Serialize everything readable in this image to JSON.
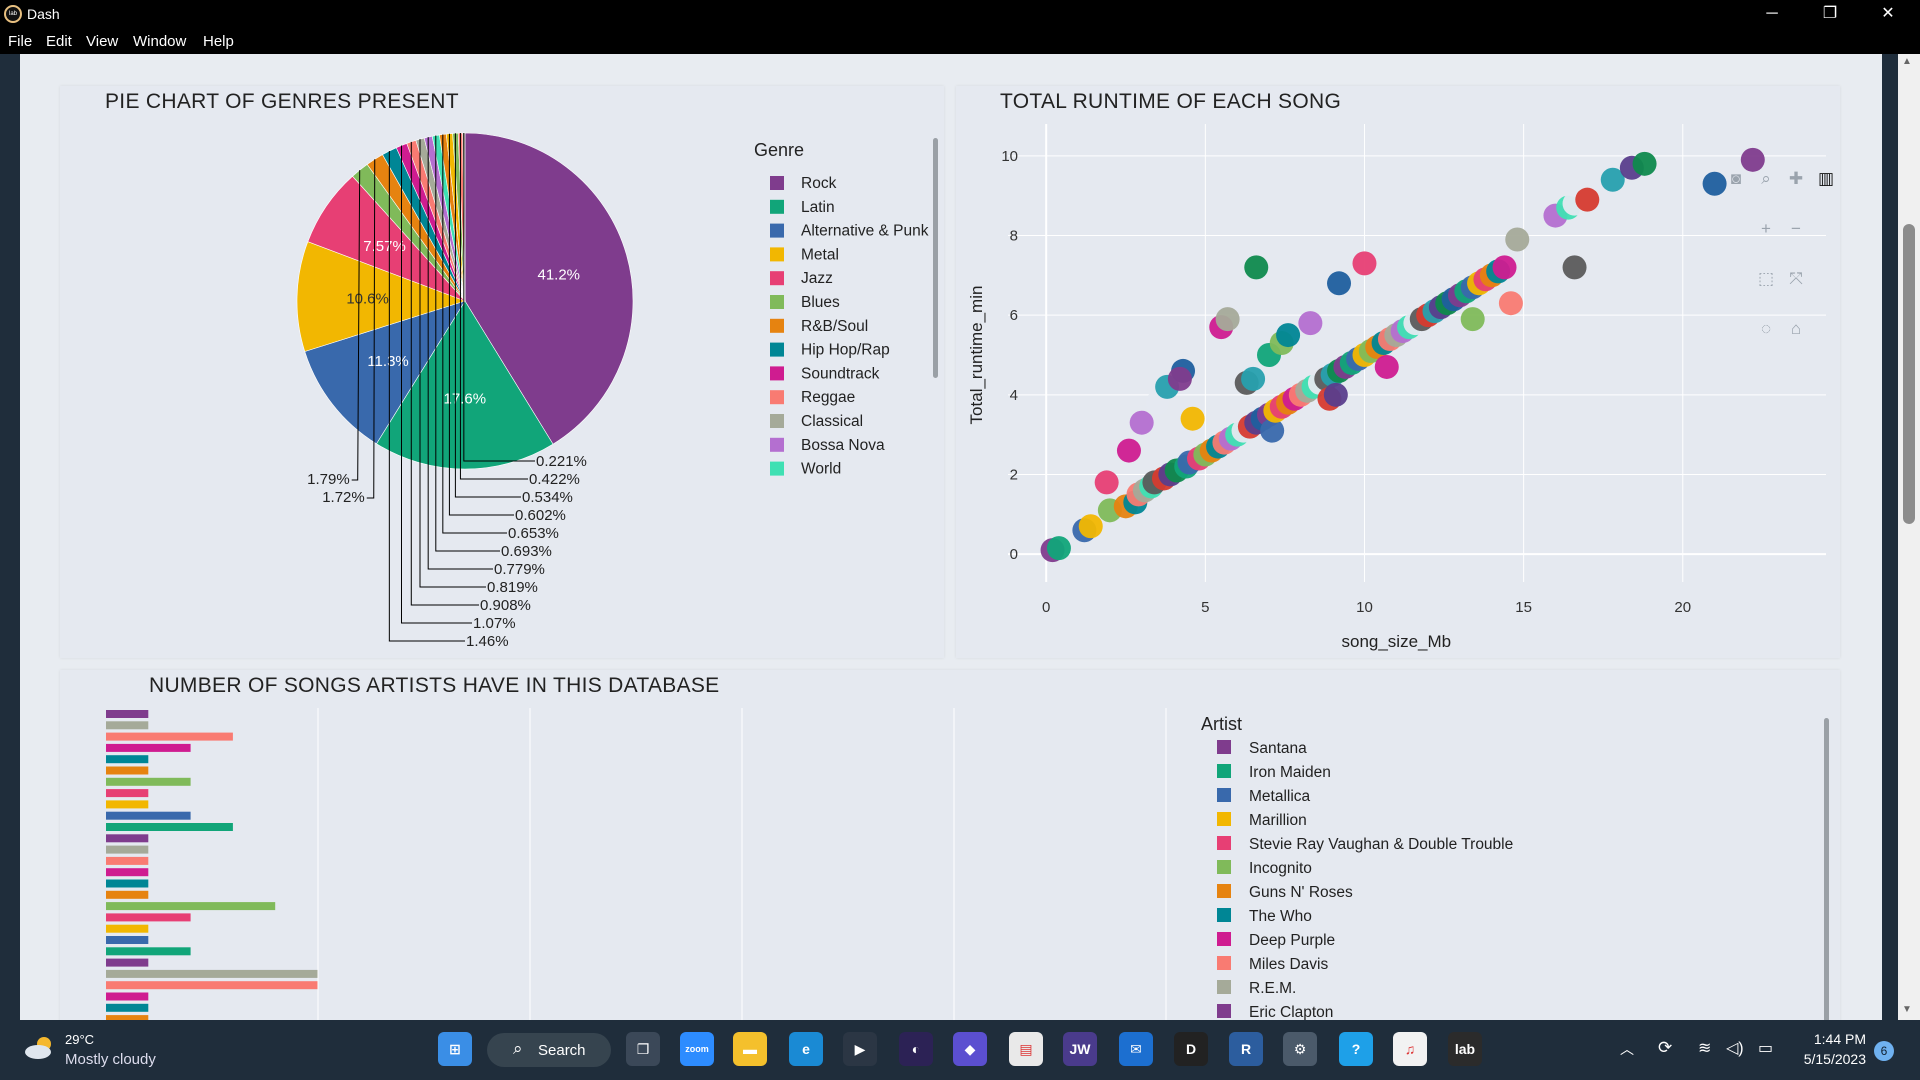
{
  "window": {
    "title": "Dash",
    "app_icon_text": "lab",
    "minimize": "─",
    "restore": "❐",
    "close": "✕"
  },
  "menu": [
    "File",
    "Edit",
    "View",
    "Window",
    "Help"
  ],
  "pie_chart": {
    "title": "PIE CHART OF GENRES PRESENT",
    "legend_title": "Genre",
    "chart_data": {
      "type": "pie",
      "labels": [
        "Rock",
        "Latin",
        "Alternative & Punk",
        "Metal",
        "Jazz",
        "Blues",
        "R&B/Soul",
        "Hip Hop/Rap",
        "Soundtrack",
        "Reggae",
        "Classical",
        "Bossa Nova",
        "World"
      ],
      "colors": [
        "#7f3c8d",
        "#11a579",
        "#3969ac",
        "#f2b701",
        "#e73f74",
        "#80ba5a",
        "#e68310",
        "#008695",
        "#cf1c90",
        "#f97b72",
        "#a5aa99",
        "#b46fd0",
        "#3fe0b3"
      ],
      "slices": [
        {
          "value": 41.2,
          "label": "41.2%",
          "color": "#7f3c8d"
        },
        {
          "value": 17.6,
          "label": "17.6%",
          "color": "#11a579"
        },
        {
          "value": 11.3,
          "label": "11.3%",
          "color": "#3969ac"
        },
        {
          "value": 10.6,
          "label": "10.6%",
          "color": "#f2b701"
        },
        {
          "value": 7.57,
          "label": "7.57%",
          "color": "#e73f74"
        },
        {
          "value": 1.79,
          "label": "1.79%",
          "color": "#80ba5a"
        },
        {
          "value": 1.72,
          "label": "1.72%",
          "color": "#e68310"
        },
        {
          "value": 1.46,
          "label": "1.46%",
          "color": "#008695"
        },
        {
          "value": 1.07,
          "label": "1.07%",
          "color": "#cf1c90"
        },
        {
          "value": 0.908,
          "label": "0.908%",
          "color": "#f97b72"
        },
        {
          "value": 0.819,
          "label": "0.819%",
          "color": "#a5aa99"
        },
        {
          "value": 0.779,
          "label": "0.779%",
          "color": "#b46fd0"
        },
        {
          "value": 0.693,
          "label": "0.693%",
          "color": "#3fe0b3"
        },
        {
          "value": 0.653,
          "label": "0.653%",
          "color": "#e68310"
        },
        {
          "value": 0.602,
          "label": "0.602%",
          "color": "#f2b701"
        },
        {
          "value": 0.534,
          "label": "0.534%",
          "color": "#80ba5a"
        },
        {
          "value": 0.422,
          "label": "0.422%",
          "color": "#f97b72"
        },
        {
          "value": 0.221,
          "label": "0.221%",
          "color": "#a5aa99"
        }
      ]
    }
  },
  "scatter_chart": {
    "title": "TOTAL RUNTIME OF EACH SONG",
    "chart_data": {
      "type": "scatter",
      "xlabel": "song_size_Mb",
      "ylabel": "Total_runtime_min",
      "xlim": [
        -1.2,
        24.5
      ],
      "ylim": [
        -0.7,
        10.8
      ],
      "xticks": [
        "0",
        "5",
        "10",
        "15",
        "20"
      ],
      "yticks": [
        "0",
        "2",
        "4",
        "6",
        "8",
        "10"
      ],
      "colors": [
        "#7f3c8d",
        "#11a579",
        "#3969ac",
        "#f2b701",
        "#e73f74",
        "#80ba5a",
        "#e68310",
        "#008695",
        "#cf1c90",
        "#f97b72",
        "#a5aa99",
        "#b46fd0",
        "#3fe0b3",
        "#e5e9f0",
        "#5b5b5b",
        "#d63b2f",
        "#27a0ae",
        "#5a3e8c",
        "#0f8a4d",
        "#1f5f9e"
      ],
      "points": [
        [
          0.2,
          0.1
        ],
        [
          0.4,
          0.15
        ],
        [
          1.2,
          0.6
        ],
        [
          1.4,
          0.7
        ],
        [
          1.9,
          1.8
        ],
        [
          2.0,
          1.1
        ],
        [
          2.5,
          1.2
        ],
        [
          2.8,
          1.3
        ],
        [
          2.6,
          2.6
        ],
        [
          2.9,
          1.5
        ],
        [
          3.1,
          1.6
        ],
        [
          3.0,
          3.3
        ],
        [
          3.3,
          1.7
        ],
        [
          3.5,
          3.8
        ],
        [
          3.4,
          1.8
        ],
        [
          3.7,
          1.9
        ],
        [
          3.8,
          4.2
        ],
        [
          3.9,
          2.0
        ],
        [
          4.1,
          2.1
        ],
        [
          4.3,
          4.6
        ],
        [
          4.2,
          4.4
        ],
        [
          4.4,
          2.2
        ],
        [
          4.5,
          2.3
        ],
        [
          4.6,
          3.4
        ],
        [
          4.8,
          2.4
        ],
        [
          5.0,
          2.5
        ],
        [
          5.2,
          2.6
        ],
        [
          5.4,
          2.7
        ],
        [
          5.5,
          5.7
        ],
        [
          5.6,
          2.8
        ],
        [
          5.7,
          5.9
        ],
        [
          5.8,
          2.9
        ],
        [
          6.0,
          3.0
        ],
        [
          6.2,
          3.1
        ],
        [
          6.3,
          4.3
        ],
        [
          6.4,
          3.2
        ],
        [
          6.5,
          4.4
        ],
        [
          6.6,
          3.3
        ],
        [
          6.6,
          7.2
        ],
        [
          6.8,
          3.4
        ],
        [
          7.0,
          3.5
        ],
        [
          7.0,
          5.0
        ],
        [
          7.1,
          3.1
        ],
        [
          7.2,
          3.6
        ],
        [
          7.4,
          3.7
        ],
        [
          7.4,
          5.3
        ],
        [
          7.6,
          3.8
        ],
        [
          7.6,
          5.5
        ],
        [
          7.8,
          3.9
        ],
        [
          8.0,
          4.0
        ],
        [
          8.2,
          4.1
        ],
        [
          8.3,
          5.8
        ],
        [
          8.4,
          4.2
        ],
        [
          8.6,
          4.3
        ],
        [
          8.8,
          4.4
        ],
        [
          8.9,
          3.9
        ],
        [
          9.0,
          4.5
        ],
        [
          9.1,
          4.0
        ],
        [
          9.2,
          4.6
        ],
        [
          9.2,
          6.8
        ],
        [
          9.4,
          4.7
        ],
        [
          9.6,
          4.8
        ],
        [
          9.8,
          4.9
        ],
        [
          10.0,
          5.0
        ],
        [
          10.0,
          7.3
        ],
        [
          10.2,
          5.1
        ],
        [
          10.4,
          5.2
        ],
        [
          10.6,
          5.3
        ],
        [
          10.7,
          4.7
        ],
        [
          10.8,
          5.4
        ],
        [
          11.0,
          5.5
        ],
        [
          11.2,
          5.6
        ],
        [
          11.4,
          5.7
        ],
        [
          11.6,
          5.8
        ],
        [
          11.8,
          5.9
        ],
        [
          12.0,
          6.0
        ],
        [
          12.2,
          6.1
        ],
        [
          12.4,
          6.2
        ],
        [
          12.6,
          6.3
        ],
        [
          12.8,
          6.4
        ],
        [
          13.0,
          6.5
        ],
        [
          13.2,
          6.6
        ],
        [
          13.4,
          6.7
        ],
        [
          13.6,
          6.8
        ],
        [
          13.8,
          6.9
        ],
        [
          13.4,
          5.9
        ],
        [
          14.0,
          7.0
        ],
        [
          14.2,
          7.1
        ],
        [
          14.4,
          7.2
        ],
        [
          14.6,
          6.3
        ],
        [
          14.8,
          7.9
        ],
        [
          16.0,
          8.5
        ],
        [
          16.4,
          8.7
        ],
        [
          16.6,
          8.8
        ],
        [
          16.6,
          7.2
        ],
        [
          17.0,
          8.9
        ],
        [
          17.8,
          9.4
        ],
        [
          18.4,
          9.7
        ],
        [
          18.8,
          9.8
        ],
        [
          21.0,
          9.3
        ],
        [
          22.2,
          9.9
        ]
      ]
    }
  },
  "plot_toolbar": [
    "camera-icon",
    "zoom-icon",
    "pan-icon",
    "autoscale-icon",
    "zoom-in-icon",
    "zoom-out-icon",
    "box-select-icon",
    "reset-axes-icon",
    "lasso-icon",
    "home-icon"
  ],
  "bar_chart": {
    "title": "NUMBER OF SONGS ARTISTS HAVE IN THIS DATABASE",
    "legend_title": "Artist",
    "legend": [
      "Santana",
      "Iron Maiden",
      "Metallica",
      "Marillion",
      "Stevie Ray Vaughan & Double Trouble",
      "Incognito",
      "Guns N' Roses",
      "The Who",
      "Deep Purple",
      "Miles Davis",
      "R.E.M.",
      "Eric Clapton"
    ],
    "legend_colors": [
      "#7f3c8d",
      "#11a579",
      "#3969ac",
      "#f2b701",
      "#e73f74",
      "#80ba5a",
      "#e68310",
      "#008695",
      "#cf1c90",
      "#f97b72",
      "#a5aa99",
      "#7f3c8d"
    ],
    "chart_data": {
      "type": "bar",
      "orientation": "horizontal",
      "values": [
        1,
        1,
        3,
        2,
        1,
        1,
        2,
        1,
        1,
        2,
        3,
        1,
        1,
        1,
        1,
        1,
        1,
        4,
        2,
        1,
        1,
        2,
        1,
        5,
        5,
        1,
        1,
        1
      ],
      "colors": [
        "#7f3c8d",
        "#a5aa99",
        "#f97b72",
        "#cf1c90",
        "#008695",
        "#e68310",
        "#80ba5a",
        "#e73f74",
        "#f2b701",
        "#3969ac",
        "#11a579",
        "#7f3c8d",
        "#a5aa99",
        "#f97b72",
        "#cf1c90",
        "#008695",
        "#e68310",
        "#80ba5a",
        "#e73f74",
        "#f2b701",
        "#3969ac",
        "#11a579",
        "#7f3c8d",
        "#a5aa99",
        "#f97b72",
        "#cf1c90",
        "#008695",
        "#e68310"
      ]
    }
  },
  "taskbar": {
    "weather_temp": "29°C",
    "weather_desc": "Mostly cloudy",
    "search_label": "Search",
    "time": "1:44 PM",
    "date": "5/15/2023",
    "notification_count": "6",
    "apps": [
      {
        "name": "start-icon",
        "glyph": "⊞",
        "color": "#3a8ee6"
      },
      {
        "name": "task-view-icon",
        "glyph": "❐",
        "color": "#3b4858"
      },
      {
        "name": "zoom-icon",
        "glyph": "zoom",
        "color": "#2d8cff"
      },
      {
        "name": "file-explorer-icon",
        "glyph": "▬",
        "color": "#f4c02c"
      },
      {
        "name": "edge-icon",
        "glyph": "e",
        "color": "#1a8ad4"
      },
      {
        "name": "media-icon",
        "glyph": "▶",
        "color": "#2b3644"
      },
      {
        "name": "eclipse-icon",
        "glyph": "◐",
        "color": "#2c2255"
      },
      {
        "name": "copilot-icon",
        "glyph": "◆",
        "color": "#5b4fd0"
      },
      {
        "name": "document-icon",
        "glyph": "▤",
        "color": "#e9e9e9"
      },
      {
        "name": "jw-icon",
        "glyph": "JW",
        "color": "#4a3b8c"
      },
      {
        "name": "mail-icon",
        "glyph": "✉",
        "color": "#1c6fd0"
      },
      {
        "name": "editor-icon",
        "glyph": "D",
        "color": "#222"
      },
      {
        "name": "r-icon",
        "glyph": "R",
        "color": "#2c5d9e"
      },
      {
        "name": "settings-icon",
        "glyph": "⚙",
        "color": "#4b5a6a"
      },
      {
        "name": "help-icon",
        "glyph": "?",
        "color": "#1ea0e8"
      },
      {
        "name": "music-icon",
        "glyph": "♫",
        "color": "#f2f2f2"
      },
      {
        "name": "jupyterlab-icon",
        "glyph": "lab",
        "color": "#2b2b2b"
      }
    ]
  }
}
